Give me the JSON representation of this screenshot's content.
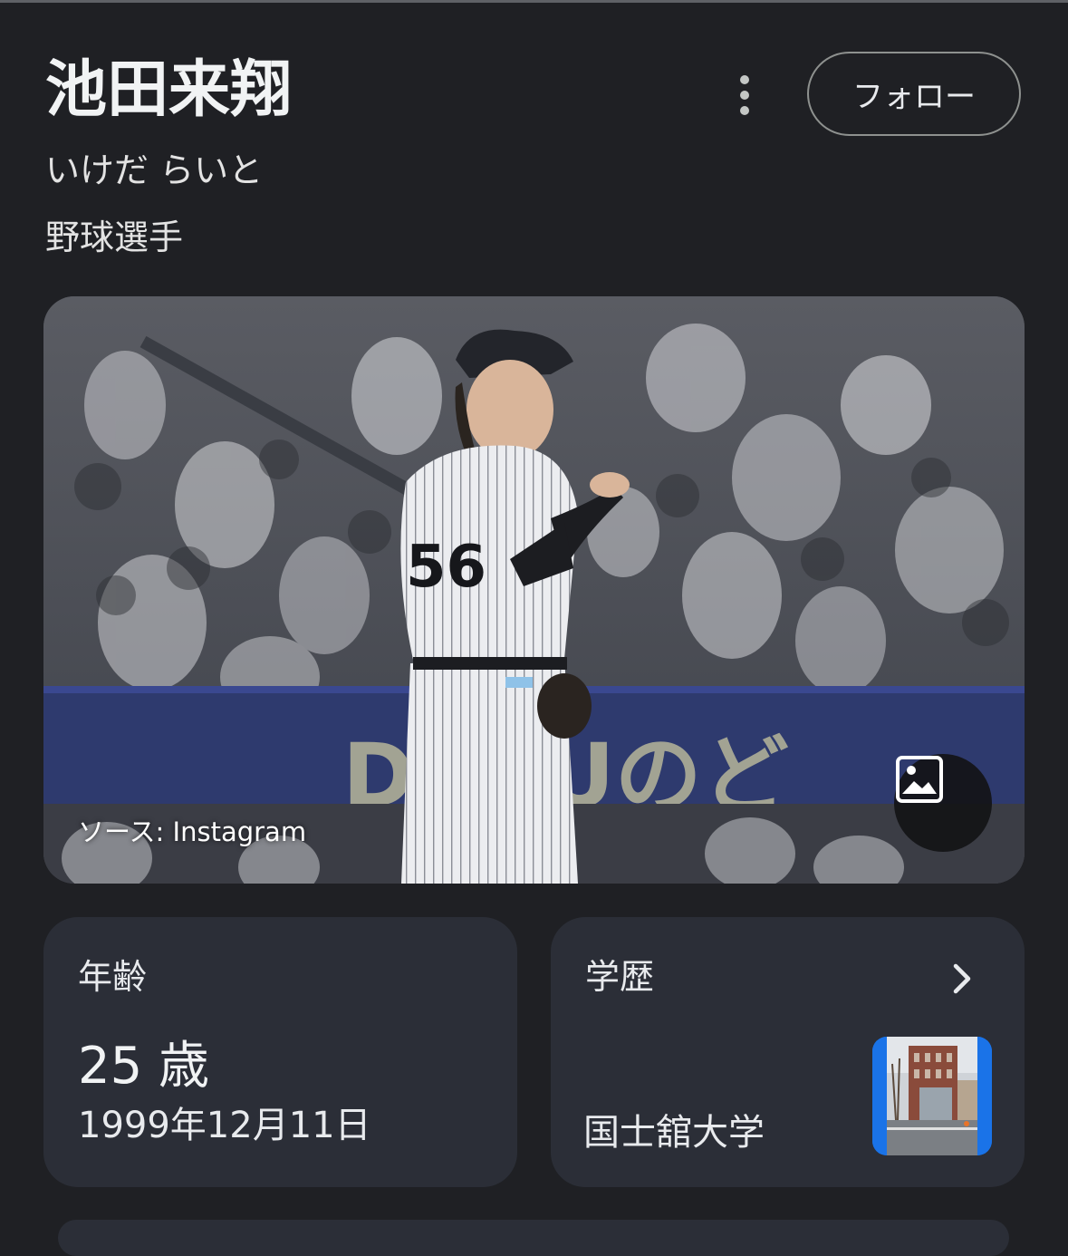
{
  "entity": {
    "name": "池田来翔",
    "reading": "いけだ らいと",
    "profession": "野球選手"
  },
  "actions": {
    "more_icon": "more-vert-icon",
    "follow_label": "フォロー"
  },
  "photo": {
    "source_label": "ソース: Instagram",
    "jersey_number": "56",
    "banner_text": "D IRUのど",
    "image_icon": "image-icon"
  },
  "cards": {
    "age": {
      "label": "年齢",
      "value": "25 歳",
      "birth_date": "1999年12月11日"
    },
    "education": {
      "label": "学歴",
      "school": "国士舘大学",
      "chevron_icon": "chevron-right-icon"
    }
  },
  "colors": {
    "background": "#1f2024",
    "card": "#2b2e37",
    "text": "#e8eaed",
    "thumb_border": "#1a73e8"
  }
}
